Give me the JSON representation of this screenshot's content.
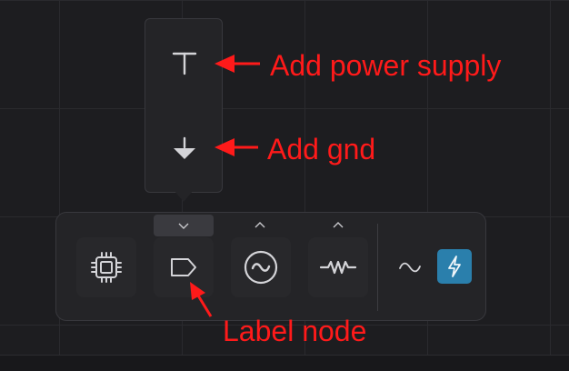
{
  "popup": {
    "items": [
      {
        "name": "power-supply",
        "icon": "power-supply-icon"
      },
      {
        "name": "ground",
        "icon": "ground-icon"
      }
    ]
  },
  "toolbar": {
    "tools": [
      {
        "name": "chip",
        "icon": "chip-icon"
      },
      {
        "name": "label-node",
        "icon": "label-node-icon",
        "expanded": true
      },
      {
        "name": "ac-source",
        "icon": "ac-source-icon"
      },
      {
        "name": "resistor",
        "icon": "resistor-icon"
      },
      {
        "name": "waveform",
        "icon": "sine-wave-icon"
      },
      {
        "name": "simulate",
        "icon": "lightning-icon",
        "active": true
      }
    ],
    "accent_color": "#2a7fac"
  },
  "annotations": {
    "power_supply": "Add power supply",
    "gnd": "Add gnd",
    "label_node": "Label node",
    "color": "#ff1a1a"
  }
}
